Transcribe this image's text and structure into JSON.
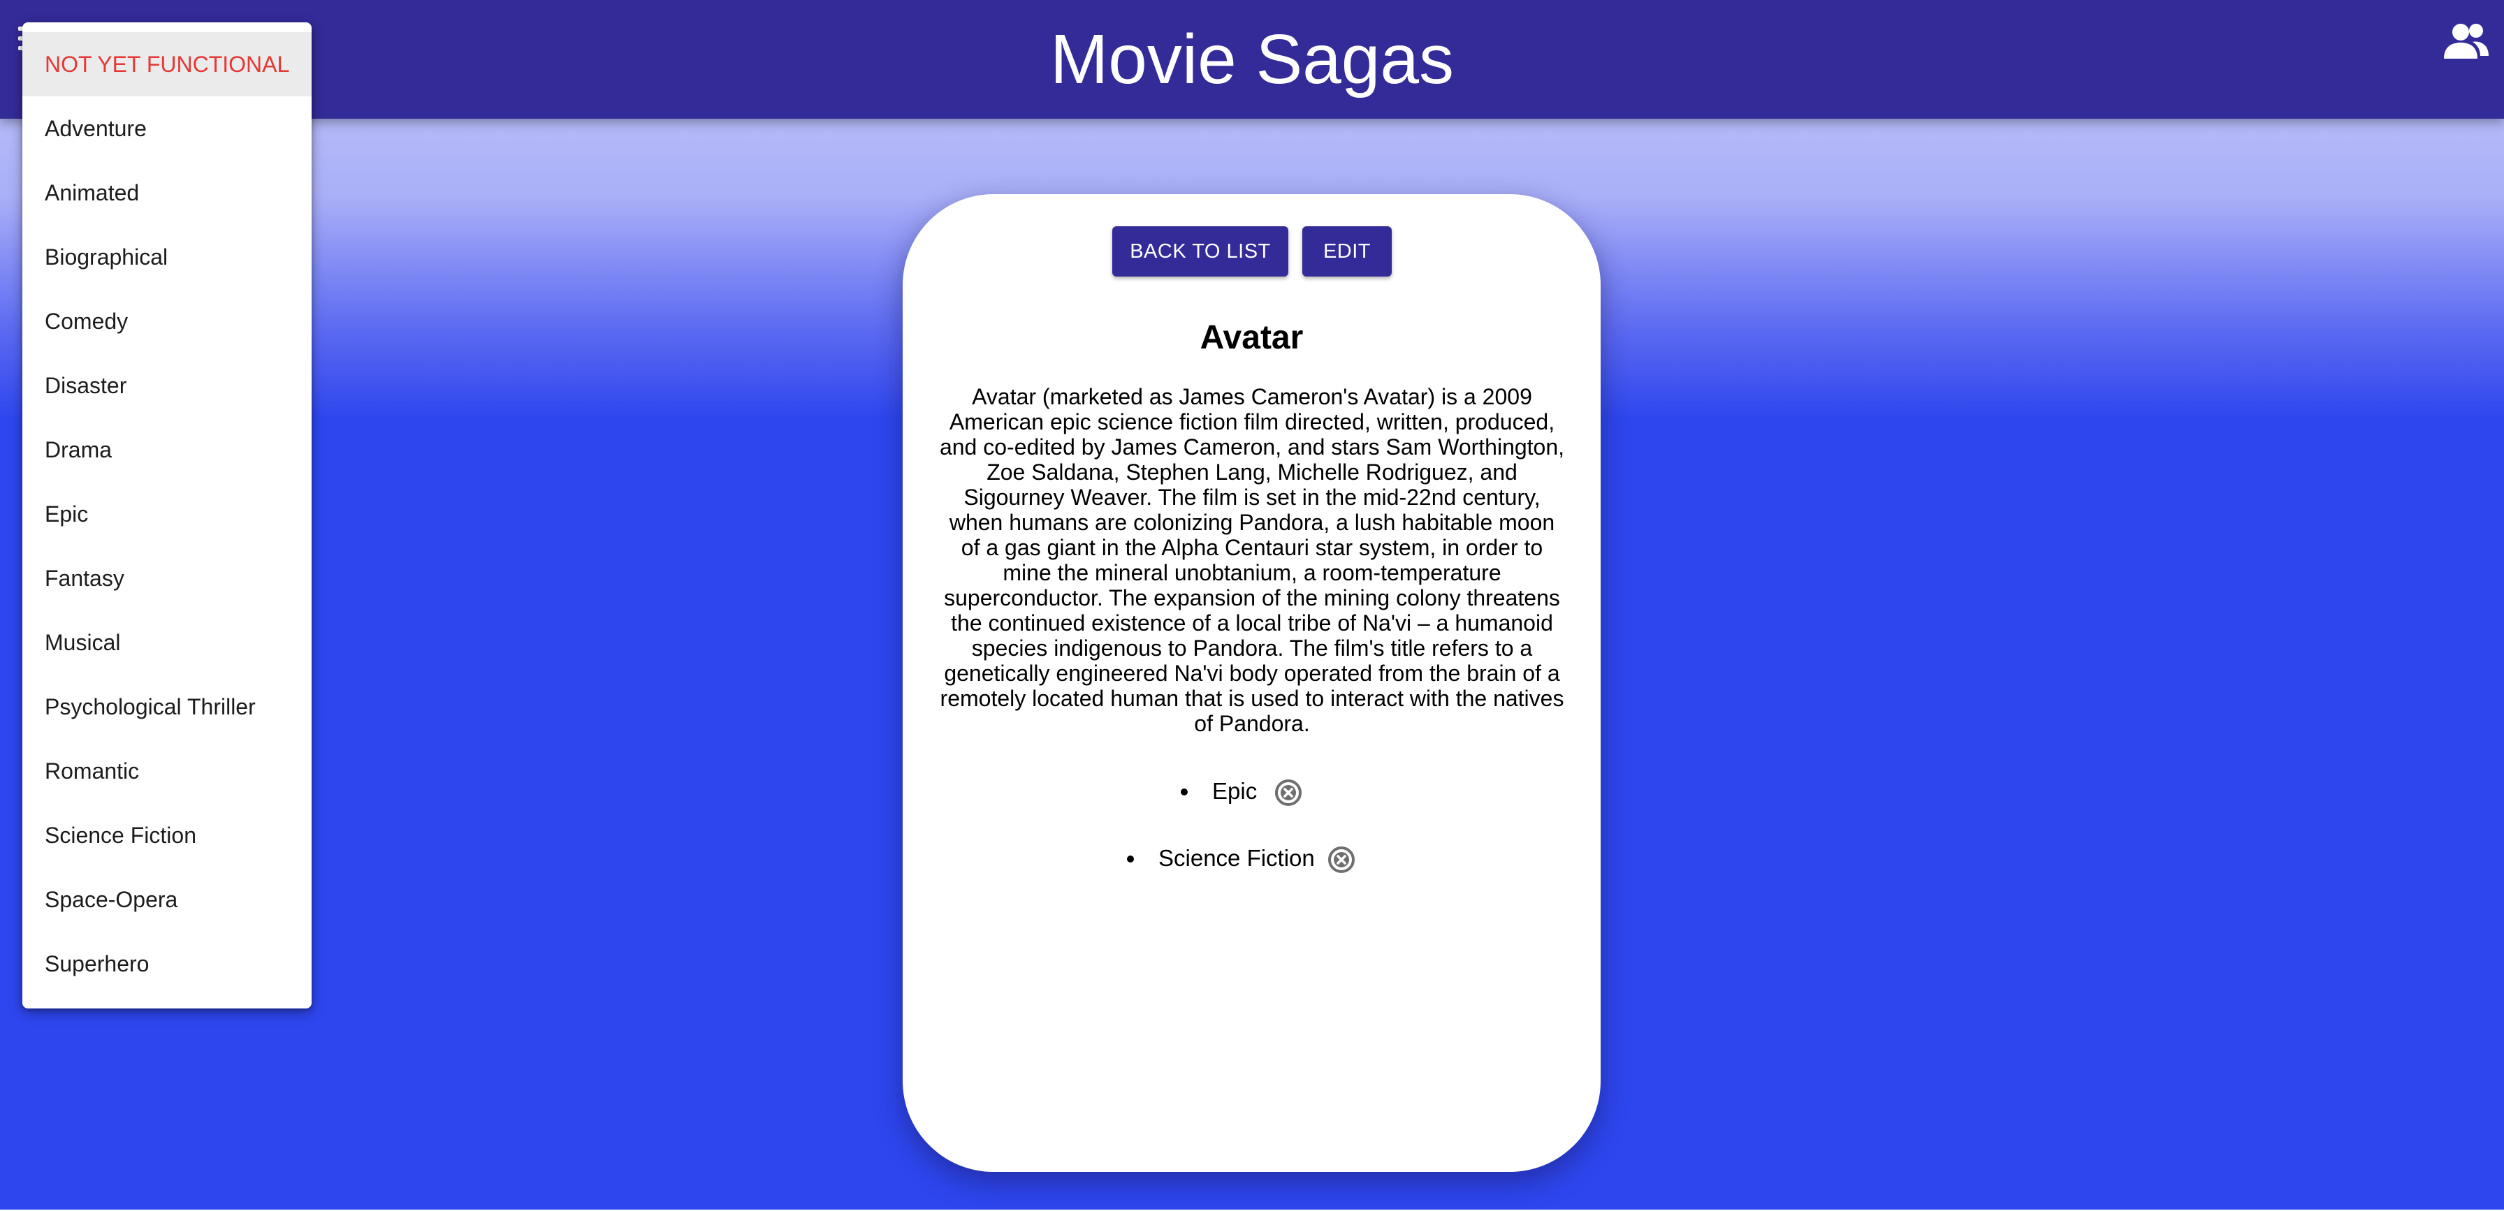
{
  "app": {
    "title": "Movie Sagas"
  },
  "icons": {
    "menu": "menu-icon",
    "account": "users-icon",
    "remove": "cancel-circle-icon"
  },
  "colors": {
    "appbar": "#332b98",
    "button": "#332b98",
    "notice_text": "#e53935",
    "background_top": "#c3c7fb",
    "background_bottom": "#2e46ee"
  },
  "genre_menu": {
    "items": [
      "NOT YET FUNCTIONAL",
      "Adventure",
      "Animated",
      "Biographical",
      "Comedy",
      "Disaster",
      "Drama",
      "Epic",
      "Fantasy",
      "Musical",
      "Psychological Thriller",
      "Romantic",
      "Science Fiction",
      "Space-Opera",
      "Superhero"
    ]
  },
  "detail": {
    "back_button": "BACK TO LIST",
    "edit_button": "EDIT",
    "title": "Avatar",
    "description": "Avatar (marketed as James Cameron's Avatar) is a 2009 American epic science fiction film directed, written, produced, and co-edited by James Cameron, and stars Sam Worthington, Zoe Saldana, Stephen Lang, Michelle Rodriguez, and Sigourney Weaver. The film is set in the mid-22nd century, when humans are colonizing Pandora, a lush habitable moon of a gas giant in the Alpha Centauri star system, in order to mine the mineral unobtanium, a room-temperature superconductor. The expansion of the mining colony threatens the continued existence of a local tribe of Na'vi – a humanoid species indigenous to Pandora. The film's title refers to a genetically engineered Na'vi body operated from the brain of a remotely located human that is used to interact with the natives of Pandora.",
    "genres": [
      "Epic",
      "Science Fiction"
    ]
  }
}
